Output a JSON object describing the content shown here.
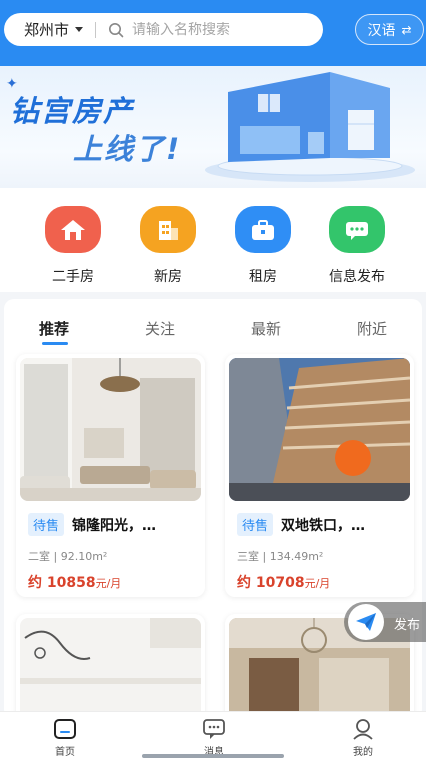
{
  "header": {
    "city": "郑州市",
    "search_placeholder": "请输入名称搜索",
    "language_button": "汉语",
    "language_swap_icon": "⇄"
  },
  "banner": {
    "line1": "钻宫房产",
    "line2": "上线了!"
  },
  "quick_entries": [
    {
      "label": "二手房",
      "icon": "house-icon",
      "color": "#f0614d"
    },
    {
      "label": "新房",
      "icon": "building-icon",
      "color": "#f5a321"
    },
    {
      "label": "租房",
      "icon": "suitcase-icon",
      "color": "#2f8ef5"
    },
    {
      "label": "信息发布",
      "icon": "chat-icon",
      "color": "#33c56b"
    }
  ],
  "tabs": [
    "推荐",
    "关注",
    "最新",
    "附近"
  ],
  "active_tab": "推荐",
  "listings": [
    {
      "badge": "待售",
      "title": "锦隆阳光，…",
      "meta": "二室 | 92.10m²",
      "price_prefix": "约",
      "price": "10858",
      "price_unit": "元/月"
    },
    {
      "badge": "待售",
      "title": "双地铁口，…",
      "meta": "三室 | 134.49m²",
      "price_prefix": "约",
      "price": "10708",
      "price_unit": "元/月"
    }
  ],
  "float_button": {
    "label": "发布"
  },
  "bottom_nav": [
    {
      "label": "首页",
      "icon": "home-icon"
    },
    {
      "label": "消息",
      "icon": "message-icon"
    },
    {
      "label": "我的",
      "icon": "profile-icon"
    }
  ],
  "colors": {
    "accent": "#2a8bf2",
    "price": "#d9432c"
  }
}
